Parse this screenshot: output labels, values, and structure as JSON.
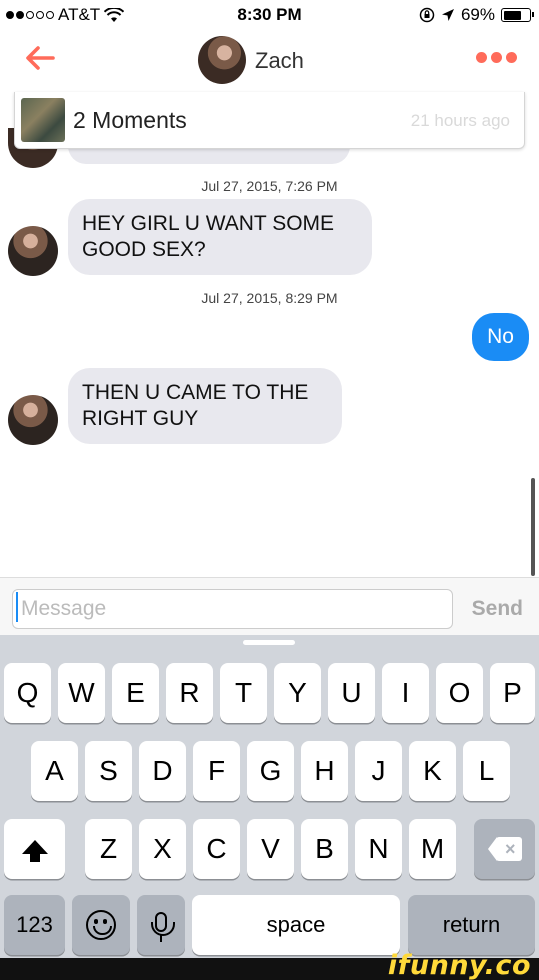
{
  "status_bar": {
    "carrier": "AT&T",
    "time": "8:30 PM",
    "battery": "69%",
    "battery_level": 0.69
  },
  "header": {
    "contact_name": "Zach",
    "back_icon": "back-arrow-icon",
    "menu_icon": "more-dots-icon",
    "accent_color": "#ff6b5a"
  },
  "moments": {
    "label": "2 Moments",
    "time": "21 hours ago"
  },
  "conversation": [
    {
      "type": "timestamp",
      "text": "Jul 27, 2015, 7:26 PM"
    },
    {
      "type": "incoming",
      "text": "HEY GIRL U WANT SOME GOOD SEX?"
    },
    {
      "type": "timestamp",
      "text": "Jul 27, 2015, 8:29 PM"
    },
    {
      "type": "outgoing",
      "text": "No"
    },
    {
      "type": "incoming",
      "text": "THEN U CAME TO THE RIGHT GUY"
    }
  ],
  "composer": {
    "placeholder": "Message",
    "value": "",
    "send_label": "Send"
  },
  "keyboard": {
    "row1": [
      "Q",
      "W",
      "E",
      "R",
      "T",
      "Y",
      "U",
      "I",
      "O",
      "P"
    ],
    "row2": [
      "A",
      "S",
      "D",
      "F",
      "G",
      "H",
      "J",
      "K",
      "L"
    ],
    "row3": [
      "Z",
      "X",
      "C",
      "V",
      "B",
      "N",
      "M"
    ],
    "numbers_label": "123",
    "space_label": "space",
    "return_label": "return"
  },
  "colors": {
    "outgoing_bubble": "#1a8cf5",
    "incoming_bubble": "#e8e8ee",
    "keyboard_bg": "#d1d5db"
  },
  "watermark": "ifunny.co"
}
